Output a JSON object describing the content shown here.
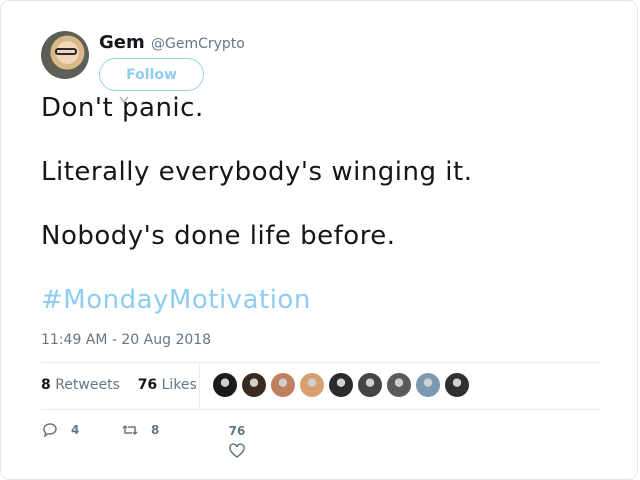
{
  "user": {
    "name": "Gem",
    "handle": "@GemCrypto",
    "follow_label": "Follow"
  },
  "tweet": {
    "lines": [
      "Don't panic.",
      "Literally everybody's winging it.",
      "Nobody's done life before."
    ],
    "hashtag": "#MondayMotivation",
    "timestamp": "11:49 AM - 20 Aug 2018"
  },
  "stats": {
    "retweets_count": "8",
    "retweets_label": "Retweets",
    "likes_count": "76",
    "likes_label": "Likes"
  },
  "liker_colors": [
    "#1a1a1a",
    "#3a2a20",
    "#c08060",
    "#d8a070",
    "#2b2b2b",
    "#444444",
    "#5a5a5a",
    "#7a9ab0",
    "#303030"
  ],
  "actions": {
    "reply_count": "4",
    "retweet_count": "8",
    "like_count": "76"
  },
  "colors": {
    "accent": "#8ecdf2",
    "muted": "#657786",
    "text": "#14171a"
  }
}
